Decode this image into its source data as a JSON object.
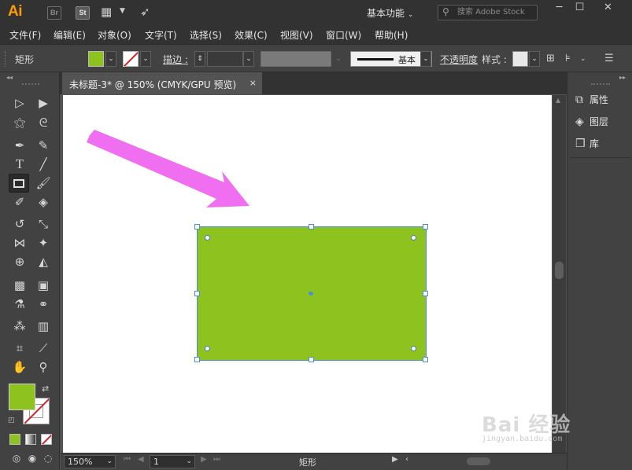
{
  "app": {
    "logo": "Ai",
    "bridge_badge": "Br",
    "stock_badge": "St",
    "workspace": "基本功能",
    "search_placeholder": "搜索 Adobe Stock"
  },
  "menu": [
    "文件(F)",
    "编辑(E)",
    "对象(O)",
    "文字(T)",
    "选择(S)",
    "效果(C)",
    "视图(V)",
    "窗口(W)",
    "帮助(H)"
  ],
  "controlbar": {
    "object_type": "矩形",
    "stroke_label": "描边 :",
    "stroke_style": "基本",
    "opacity_label": "不透明度",
    "style_label": "样式 :"
  },
  "document": {
    "tab_title": "未标题-3* @ 150% (CMYK/GPU 预览)",
    "close": "×"
  },
  "right_panel": {
    "items": [
      "属性",
      "图层",
      "库"
    ]
  },
  "statusbar": {
    "zoom": "150%",
    "artboard": "1",
    "current_tool": "矩形"
  },
  "colors": {
    "fill": "#8dc21f",
    "arrow": "#f06ef0",
    "selection": "#4a90d9"
  },
  "watermark": {
    "brand": "Bai 经验",
    "url": "jingyan.baidu.com"
  }
}
